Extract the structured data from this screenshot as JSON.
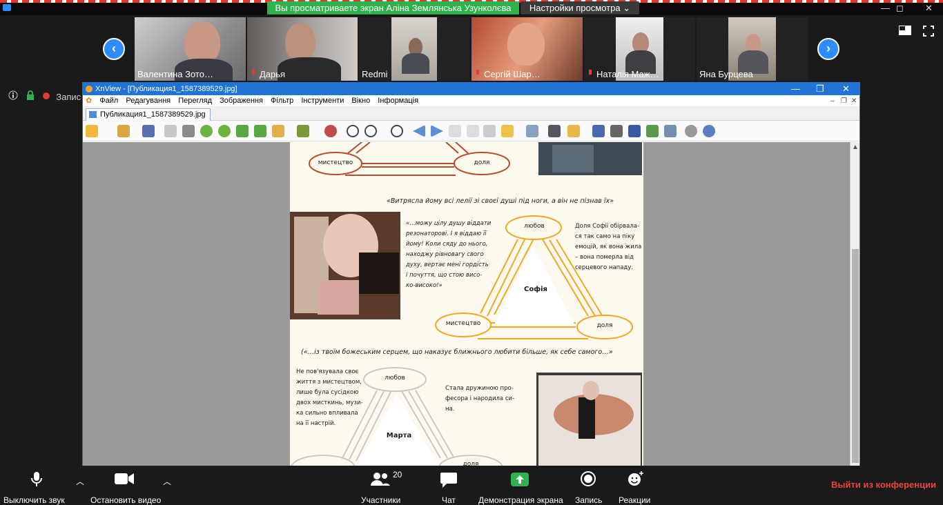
{
  "zoom": {
    "share_banner": "Вы просматриваете экран Аліна Землянська Узунколєва",
    "view_options": "Настройки просмотра",
    "view_options_caret": "⌄",
    "window_controls": [
      "—",
      "◻",
      "✕"
    ],
    "recording_label": "Запис",
    "participants_gallery": [
      {
        "name": "Валентина Зото…",
        "muted": false
      },
      {
        "name": "Дарья",
        "muted": true
      },
      {
        "name": "Redmi",
        "muted": false
      },
      {
        "name": "Сергій Шар…",
        "muted": true
      },
      {
        "name": "Наталія Маж…",
        "muted": true
      },
      {
        "name": "Яна Бурцева",
        "muted": false
      }
    ],
    "gallery_prev": "‹",
    "gallery_next": "›",
    "bottom": {
      "mute": "Выключить звук",
      "video": "Остановить видео",
      "participants": "Участники",
      "participants_count": "20",
      "chat": "Чат",
      "share": "Демонстрация экрана",
      "record": "Запись",
      "reactions": "Реакции",
      "leave": "Выйти из конференции"
    },
    "colors": {
      "accent": "#2d8cff",
      "share_green": "#2fb24c",
      "leave_red": "#e8453c"
    }
  },
  "xnview": {
    "title": "XnView - [Публикация1_1587389529.jpg]",
    "title_controls": [
      "—",
      "❐",
      "✕"
    ],
    "menu": [
      "Файл",
      "Редагування",
      "Перегляд",
      "Зображення",
      "Фільтр",
      "Інструменти",
      "Вікно",
      "Інформація"
    ],
    "menu_controls": [
      "–",
      "❐",
      "✕"
    ],
    "tab": "Публикация1_1587389529.jpg"
  },
  "image_content": {
    "top_ovals": {
      "left": "мистецтво",
      "right": "доля"
    },
    "quote1": "«Витрясла йому всі лелії зі своєї душі під ноги, а він не пізнав їх»",
    "sofia_quote_lines": [
      "«…можу цілу душу віддати",
      "резонаторові. І я віддаю її",
      "йому! Коли сяду до нього,",
      "находжу рівновагу свого",
      "духу, вертає мені гордість",
      "і почуття, що стою висо-",
      "ко-високо!»"
    ],
    "sofia_triangle": {
      "top": "любов",
      "center": "Софія",
      "left": "мистецтво",
      "right": "доля"
    },
    "sofia_note_lines": [
      "Доля Софії обірвала-",
      "ся так само на піку",
      "емоцій, як вона жила",
      "– вона померла від",
      "серцевого нападу."
    ],
    "quote2": "(«…із твоїм божеським серцем, що наказує ближнього любити більше, як себе самого…»",
    "marta_left_lines": [
      "Не пов'язувала своє",
      "життя з мистецтвом,",
      "лише була сусідкою",
      "двох мисткинь, музи-",
      "ка сильно впливала",
      "на її настрій."
    ],
    "marta_triangle": {
      "top": "любов",
      "center": "Марта",
      "right": "доля"
    },
    "marta_right_lines": [
      "Стала дружиною про-",
      "фесора і народила си-",
      "на."
    ]
  }
}
